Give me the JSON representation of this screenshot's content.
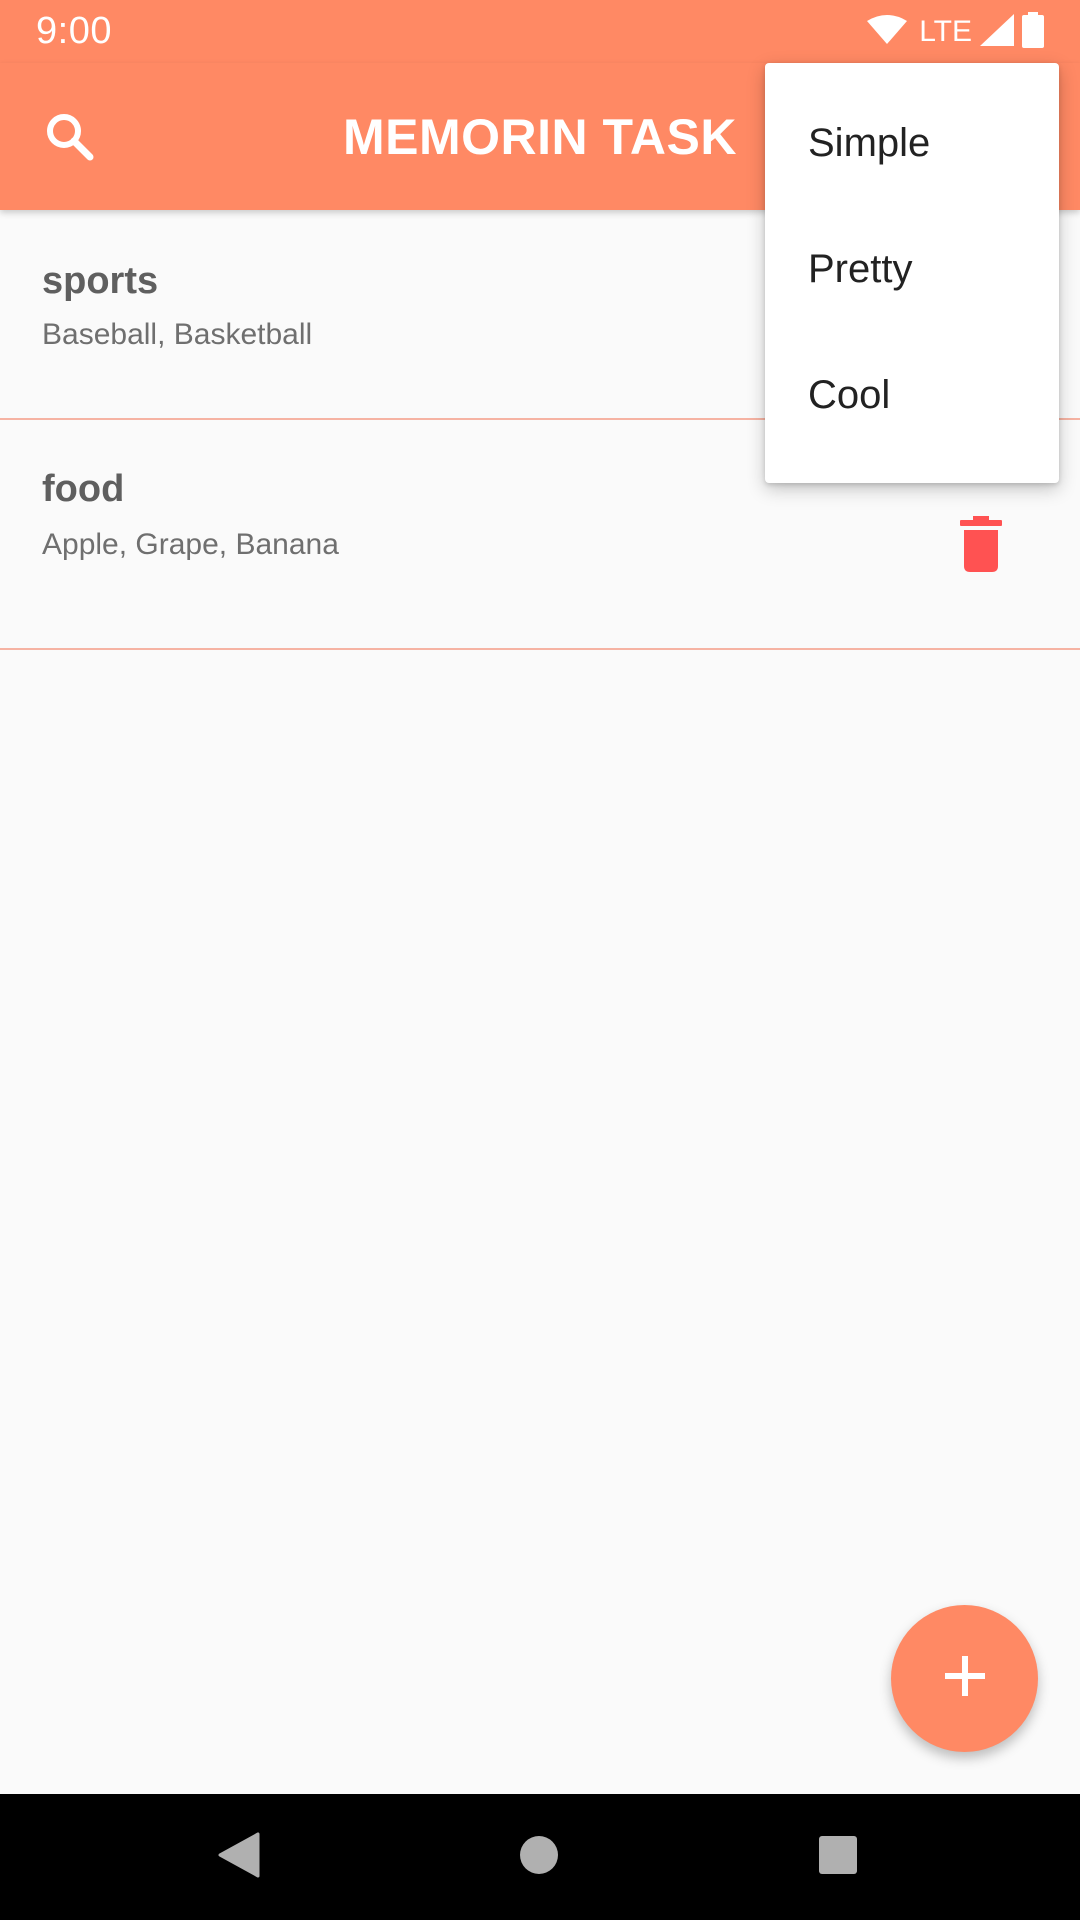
{
  "status_bar": {
    "time": "9:00",
    "network_label": "LTE",
    "icons": [
      "wifi-icon",
      "cell-signal-icon",
      "battery-icon"
    ]
  },
  "app_bar": {
    "title": "MEMORIN TASK",
    "search_icon": "search-icon"
  },
  "tasks": [
    {
      "title": "sports",
      "items": "Baseball, Basketball"
    },
    {
      "title": "food",
      "items": "Apple, Grape, Banana",
      "delete_icon": "trash-icon"
    }
  ],
  "menu": {
    "items": [
      "Simple",
      "Pretty",
      "Cool"
    ]
  },
  "fab": {
    "icon": "plus-icon"
  },
  "nav": {
    "icons": [
      "back-icon",
      "home-icon",
      "recents-icon"
    ]
  },
  "colors": {
    "primary": "#ff8964",
    "delete": "#ff5252",
    "divider": "#f6b3a3",
    "background": "#fafafa"
  }
}
